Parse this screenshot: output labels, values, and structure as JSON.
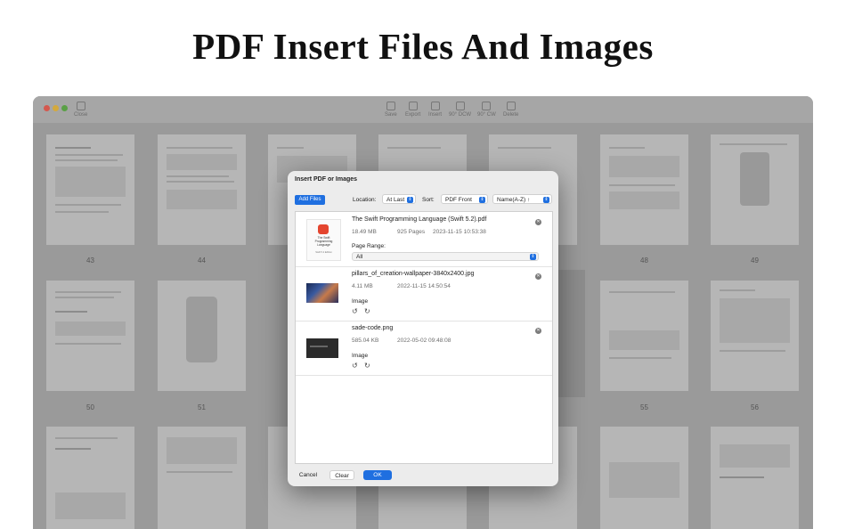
{
  "headline": "PDF Insert Files And Images",
  "app": {
    "toolbar": {
      "left_button": "Close",
      "buttons": [
        "Save",
        "Export",
        "Insert",
        "90° DCW",
        "90° CW",
        "Delete"
      ]
    },
    "page_numbers": [
      "43",
      "44",
      "48",
      "49",
      "50",
      "51",
      "55",
      "56"
    ]
  },
  "dialog": {
    "title": "Insert PDF or Images",
    "add_files_label": "Add Files",
    "location_label": "Location:",
    "location_value": "At Last",
    "sort_label": "Sort:",
    "sort_value": "PDF Front",
    "order_value": "Name(A-Z) ↑",
    "items": [
      {
        "name": "The Swift Programming Language (Swift 5.2).pdf",
        "size": "18.49 MB",
        "pages": "925 Pages",
        "date": "2023-11-15 10:53:38",
        "range_label": "Page Range:",
        "range_value": "All",
        "cover_title": "The Swift Programming Language",
        "cover_sub": "Swift 5.2 Edition"
      },
      {
        "name": "pillars_of_creation-wallpaper-3840x2400.jpg",
        "size": "4.11 MB",
        "date": "2022-11-15 14:50:54",
        "kind": "Image"
      },
      {
        "name": "sade-code.png",
        "size": "585.04 KB",
        "date": "2022-05-02 09:48:08",
        "kind": "Image"
      }
    ],
    "cancel_label": "Cancel",
    "clear_label": "Clear",
    "ok_label": "OK"
  },
  "colors": {
    "accent": "#1f6fe0",
    "overlay": "#9a9a9a"
  }
}
